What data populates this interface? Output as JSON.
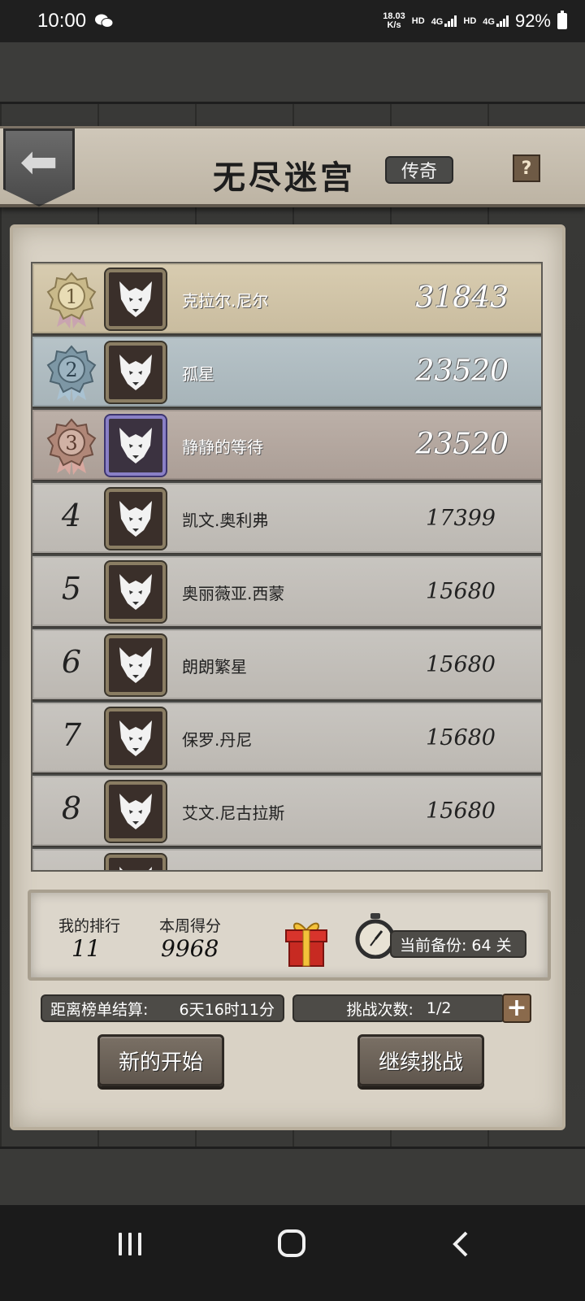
{
  "status": {
    "time": "10:00",
    "net_speed_value": "18.03",
    "net_speed_unit": "K/s",
    "hd1": "HD",
    "sig1": "4G",
    "hd2": "HD",
    "sig2": "4G",
    "battery": "92%"
  },
  "header": {
    "back_icon": "back-arrow-icon",
    "title": "无尽迷宫",
    "badge": "传奇",
    "help": "?"
  },
  "leaderboard": [
    {
      "rank": "1",
      "name": "克拉尔.尼尔",
      "score": "31843",
      "tier": "gold"
    },
    {
      "rank": "2",
      "name": "孤星",
      "score": "23520",
      "tier": "silver"
    },
    {
      "rank": "3",
      "name": "静静的等待",
      "score": "23520",
      "tier": "bronze"
    },
    {
      "rank": "4",
      "name": "凯文.奥利弗",
      "score": "17399",
      "tier": "plain"
    },
    {
      "rank": "5",
      "name": "奥丽薇亚.西蒙",
      "score": "15680",
      "tier": "plain"
    },
    {
      "rank": "6",
      "name": "朗朗繁星",
      "score": "15680",
      "tier": "plain"
    },
    {
      "rank": "7",
      "name": "保罗.丹尼",
      "score": "15680",
      "tier": "plain"
    },
    {
      "rank": "8",
      "name": "艾文.尼古拉斯",
      "score": "15680",
      "tier": "plain"
    }
  ],
  "mine": {
    "rank_label": "我的排行",
    "rank_value": "11",
    "score_label": "本周得分",
    "score_value": "9968",
    "backup_label": "当前备份:",
    "backup_value": "64 关"
  },
  "footer": {
    "timeleft_label": "距离榜单结算:",
    "timeleft_value": "6天16时11分",
    "tries_label": "挑战次数:",
    "tries_value": "1/2",
    "plus": "+",
    "new_start": "新的开始",
    "continue": "继续挑战"
  },
  "colors": {
    "gold_row": "#d8ccb0",
    "silver_row": "#b7c3c8",
    "bronze_row": "#bcb0a8",
    "plain_row": "#c8c5c0",
    "button": "#6b6259"
  }
}
